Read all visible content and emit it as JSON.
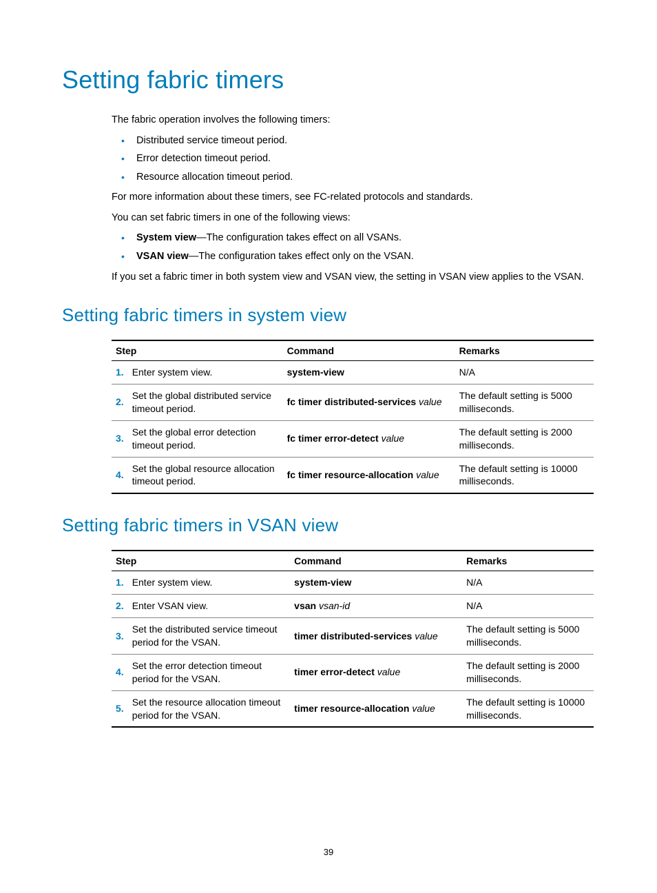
{
  "title": "Setting fabric timers",
  "intro": {
    "lead": "The fabric operation involves the following timers:",
    "timers": [
      "Distributed service timeout period.",
      "Error detection timeout period.",
      "Resource allocation timeout period."
    ],
    "more_info": "For more information about these timers, see FC-related protocols and standards.",
    "views_lead": "You can set fabric timers in one of the following views:",
    "views": [
      {
        "name": "System view",
        "desc": "—The configuration takes effect on all VSANs."
      },
      {
        "name": "VSAN view",
        "desc": "—The configuration takes effect only on the VSAN."
      }
    ],
    "both_views_note": "If you set a fabric timer in both system view and VSAN view, the setting in VSAN view applies to the VSAN."
  },
  "section1": {
    "heading": "Setting fabric timers in system view",
    "headers": {
      "step": "Step",
      "command": "Command",
      "remarks": "Remarks"
    },
    "rows": [
      {
        "num": "1.",
        "step": "Enter system view.",
        "cmd_bold": "system-view",
        "cmd_arg": "",
        "remarks": "N/A"
      },
      {
        "num": "2.",
        "step": "Set the global distributed service timeout period.",
        "cmd_bold": "fc timer distributed-services",
        "cmd_arg": "value",
        "remarks": "The default setting is 5000 milliseconds."
      },
      {
        "num": "3.",
        "step": "Set the global error detection timeout period.",
        "cmd_bold": "fc timer error-detect",
        "cmd_arg": "value",
        "remarks": "The default setting is 2000 milliseconds."
      },
      {
        "num": "4.",
        "step": "Set the global resource allocation timeout period.",
        "cmd_bold": "fc timer resource-allocation",
        "cmd_arg": "value",
        "remarks": "The default setting is 10000 milliseconds."
      }
    ]
  },
  "section2": {
    "heading": "Setting fabric timers in VSAN view",
    "headers": {
      "step": "Step",
      "command": "Command",
      "remarks": "Remarks"
    },
    "rows": [
      {
        "num": "1.",
        "step": "Enter system view.",
        "cmd_bold": "system-view",
        "cmd_arg": "",
        "remarks": "N/A"
      },
      {
        "num": "2.",
        "step": "Enter VSAN view.",
        "cmd_bold": "vsan",
        "cmd_arg": "vsan-id",
        "remarks": "N/A"
      },
      {
        "num": "3.",
        "step": "Set the distributed service timeout period for the VSAN.",
        "cmd_bold": "timer distributed-services",
        "cmd_arg": "value",
        "remarks": "The default setting is 5000 milliseconds."
      },
      {
        "num": "4.",
        "step": "Set the error detection timeout period for the VSAN.",
        "cmd_bold": "timer error-detect",
        "cmd_arg": "value",
        "remarks": "The default setting is 2000 milliseconds."
      },
      {
        "num": "5.",
        "step": "Set the resource allocation timeout period for the VSAN.",
        "cmd_bold": "timer resource-allocation",
        "cmd_arg": "value",
        "remarks": "The default setting is 10000 milliseconds."
      }
    ]
  },
  "page_number": "39"
}
